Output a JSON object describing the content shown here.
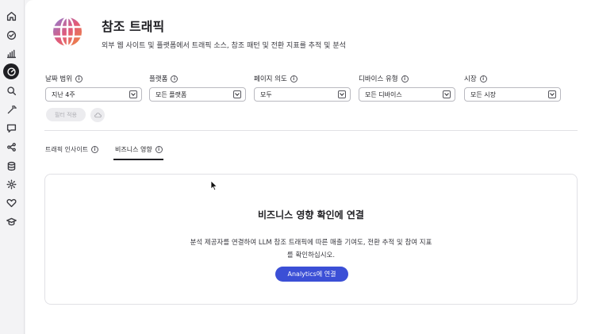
{
  "sidebar": {
    "items": [
      {
        "icon": "home-icon"
      },
      {
        "icon": "check-circle-icon"
      },
      {
        "icon": "bar-chart-icon"
      },
      {
        "icon": "gauge-icon",
        "active": true
      },
      {
        "icon": "search-icon"
      },
      {
        "icon": "magic-wand-icon"
      },
      {
        "icon": "chat-icon"
      },
      {
        "icon": "share-icon"
      },
      {
        "icon": "database-icon"
      },
      {
        "icon": "gear-icon"
      },
      {
        "icon": "heart-icon"
      },
      {
        "icon": "graduation-cap-icon"
      }
    ]
  },
  "header": {
    "title": "참조 트래픽",
    "subtitle": "외부 웹 사이트 및 플랫폼에서 트래픽 소스, 참조 패턴 및 전환 지표를 추적 및 분석"
  },
  "filters": [
    {
      "label": "날짜 범위",
      "value": "지난 4주"
    },
    {
      "label": "플랫폼",
      "value": "모든 플랫폼"
    },
    {
      "label": "페이지 의도",
      "value": "모두"
    },
    {
      "label": "디바이스 유형",
      "value": "모든 디바이스"
    },
    {
      "label": "시장",
      "value": "모든 시장"
    }
  ],
  "actions": {
    "apply_label": "필터 적용"
  },
  "tabs": [
    {
      "label": "트래픽 인사이트",
      "active": false
    },
    {
      "label": "비즈니스 영향",
      "active": true
    }
  ],
  "card": {
    "title": "비즈니스 영향 확인에 연결",
    "description": "분석 제공자를 연결하여 LLM 참조 트래픽에 따른 매출 기여도, 전환 추적 및 참여 지표를 확인하십시오.",
    "button_label": "Analytics에 연결"
  },
  "colors": {
    "accent": "#3b4fd6",
    "active_nav": "#1f1f23"
  }
}
